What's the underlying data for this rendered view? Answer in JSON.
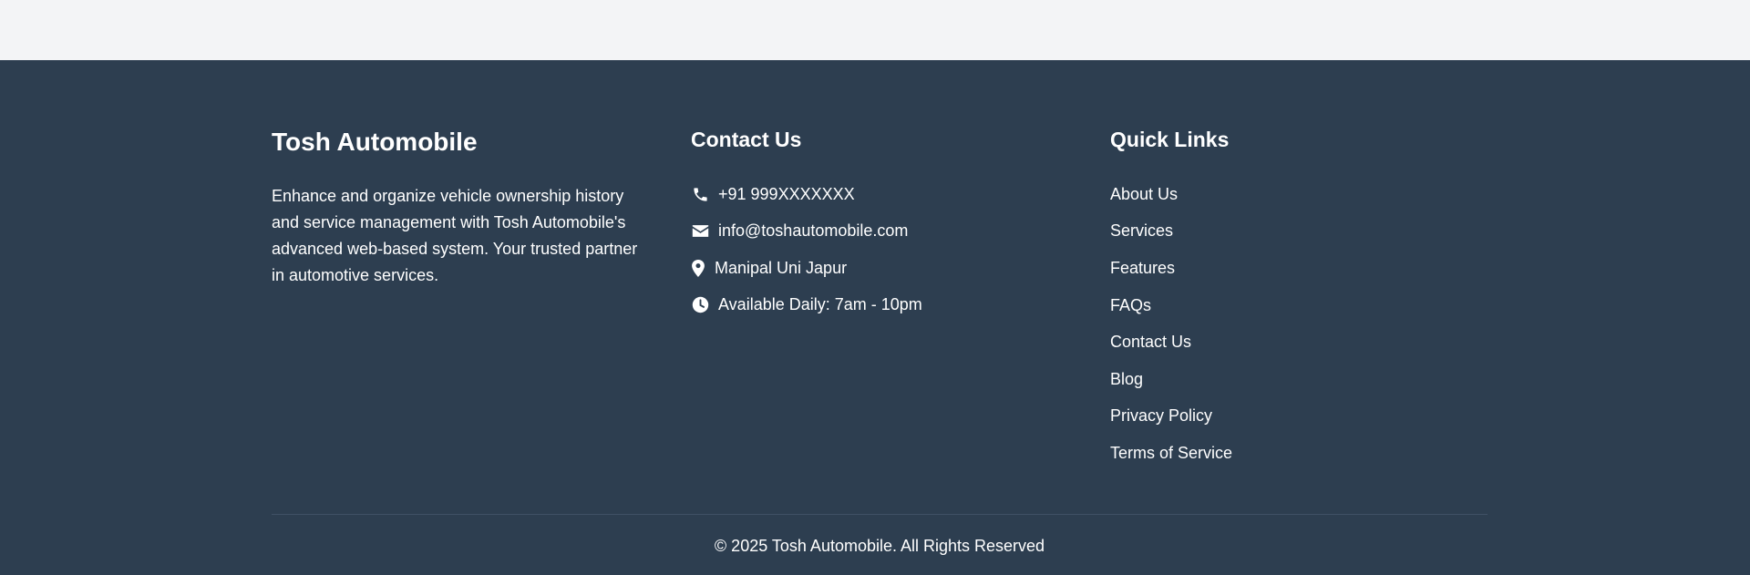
{
  "footer": {
    "brand": {
      "title": "Tosh Automobile",
      "description": "Enhance and organize vehicle ownership history and service management with Tosh Automobile's advanced web-based system. Your trusted partner in automotive services."
    },
    "contact": {
      "heading": "Contact Us",
      "phone": {
        "icon": "phone-icon",
        "text": "+91 999XXXXXXX"
      },
      "email": {
        "icon": "envelope-icon",
        "text": "info@toshautomobile.com"
      },
      "location": {
        "icon": "map-pin-icon",
        "text": "Manipal Uni Japur"
      },
      "hours": {
        "icon": "clock-icon",
        "text": "Available Daily: 7am - 10pm"
      }
    },
    "quick_links": {
      "heading": "Quick Links",
      "items": [
        {
          "label": "About Us"
        },
        {
          "label": "Services"
        },
        {
          "label": "Features"
        },
        {
          "label": "FAQs"
        },
        {
          "label": "Contact Us"
        },
        {
          "label": "Blog"
        },
        {
          "label": "Privacy Policy"
        },
        {
          "label": "Terms of Service"
        }
      ]
    },
    "copyright": "© 2025 Tosh Automobile. All Rights Reserved"
  },
  "colors": {
    "page_background": "#f3f4f6",
    "footer_background": "#2d3e50",
    "text": "#ffffff",
    "divider": "#3f5064"
  }
}
